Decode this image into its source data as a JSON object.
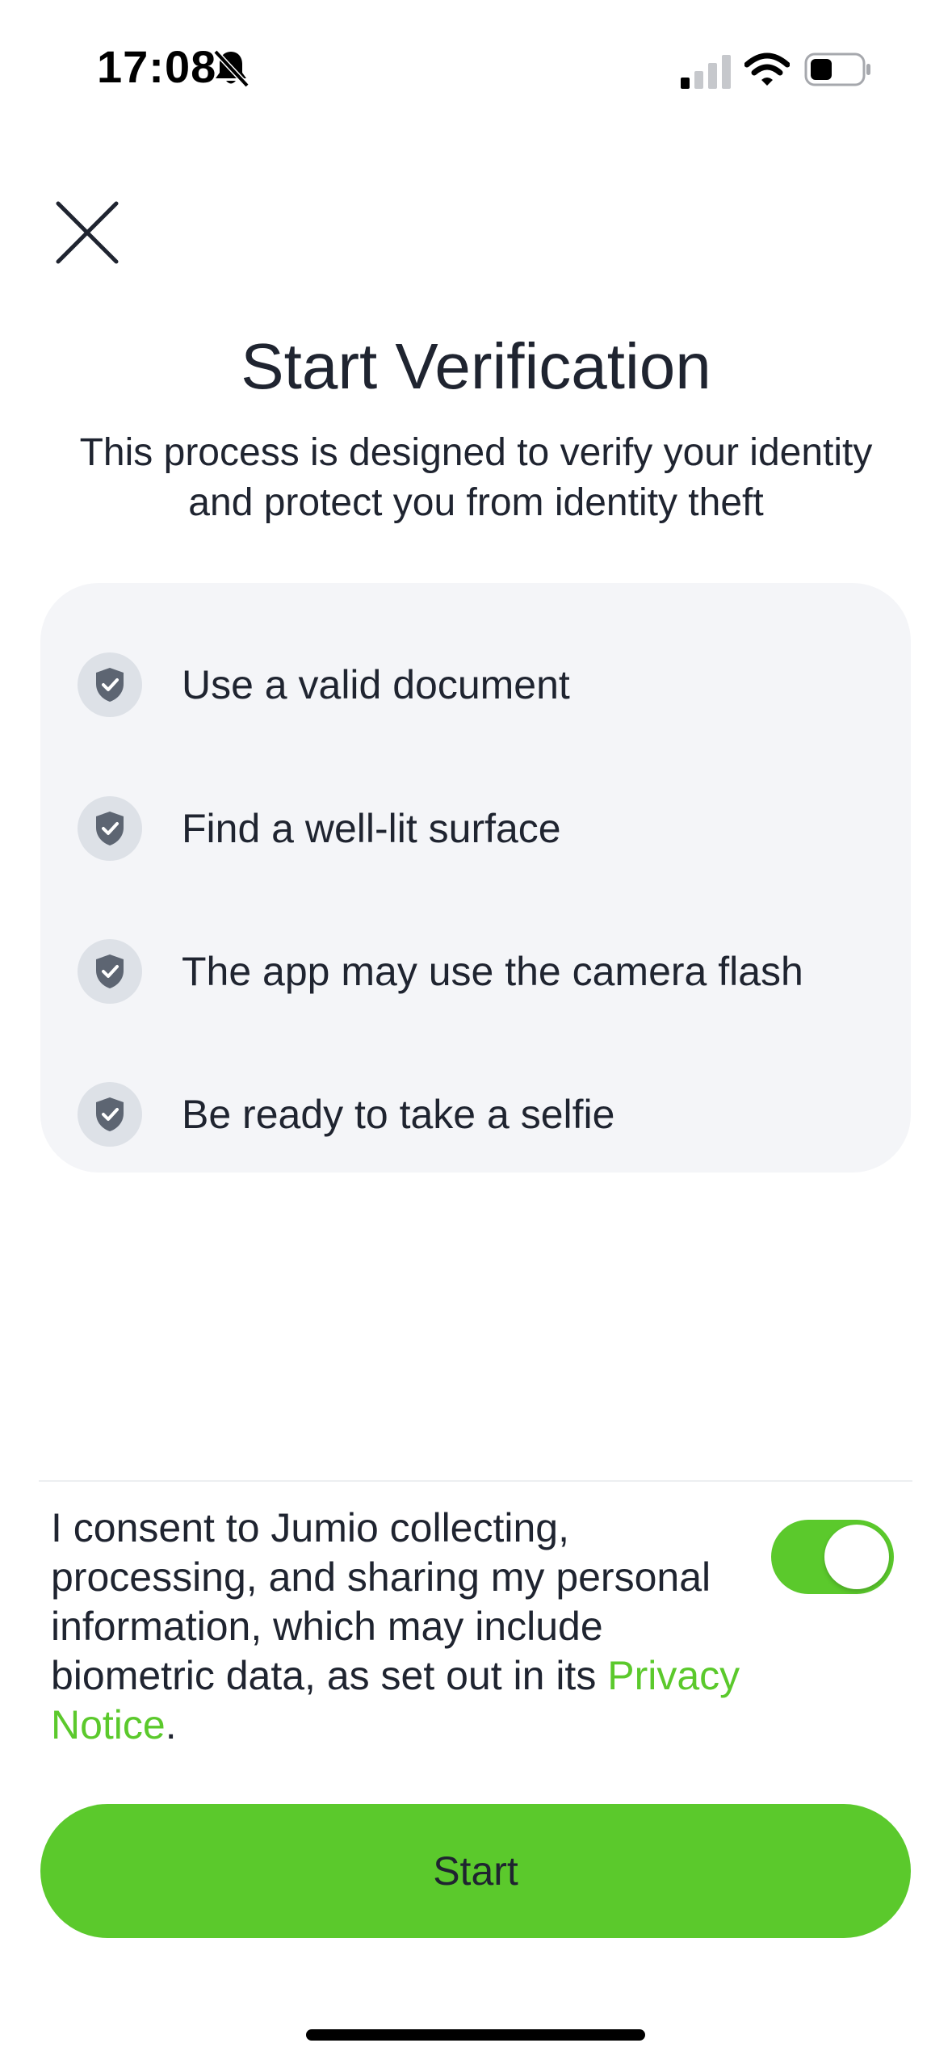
{
  "status_bar": {
    "time": "17:08",
    "icons": [
      "bell-slash-icon",
      "signal-icon",
      "wifi-icon",
      "battery-icon"
    ]
  },
  "header": {
    "close_icon": "close-icon"
  },
  "main": {
    "title": "Start Verification",
    "subtitle": "This process is designed to verify your identity and protect you from identity theft",
    "checklist": [
      {
        "icon": "shield-check-icon",
        "label": "Use a valid document"
      },
      {
        "icon": "shield-check-icon",
        "label": "Find a well-lit surface"
      },
      {
        "icon": "shield-check-icon",
        "label": "The app may use the camera flash"
      },
      {
        "icon": "shield-check-icon",
        "label": "Be ready to take a selfie"
      }
    ]
  },
  "consent": {
    "text": "I consent to Jumio collecting, processing, and sharing my personal information, which may include biometric data, as set out in its ",
    "link_label": "Privacy Notice",
    "text_end": ".",
    "toggle_on": true
  },
  "footer": {
    "start_label": "Start"
  },
  "colors": {
    "accent": "#5bc92c",
    "text": "#1f2430",
    "card_bg": "#f4f5f8",
    "icon_badge": "#dde1e7",
    "icon_fill": "#5d6572"
  }
}
